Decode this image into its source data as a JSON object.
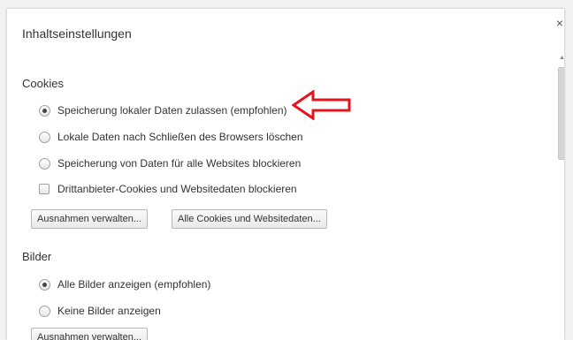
{
  "dialog": {
    "title": "Inhaltseinstellungen",
    "close_glyph": "×"
  },
  "cookies": {
    "heading": "Cookies",
    "options": [
      {
        "label": "Speicherung lokaler Daten zulassen (empfohlen)",
        "checked": true
      },
      {
        "label": "Lokale Daten nach Schließen des Browsers löschen",
        "checked": false
      },
      {
        "label": "Speicherung von Daten für alle Websites blockieren",
        "checked": false
      }
    ],
    "checkbox_label": "Drittanbieter-Cookies und Websitedaten blockieren",
    "checkbox_checked": false,
    "buttons": {
      "exceptions": "Ausnahmen verwalten...",
      "all_cookies": "Alle Cookies und Websitedaten..."
    }
  },
  "images": {
    "heading": "Bilder",
    "options": [
      {
        "label": "Alle Bilder anzeigen (empfohlen)",
        "checked": true
      },
      {
        "label": "Keine Bilder anzeigen",
        "checked": false
      }
    ],
    "buttons": {
      "exceptions": "Ausnahmen verwalten..."
    }
  },
  "annotation": {
    "arrow_color": "#e3141b",
    "arrow_icon": "arrow-left-outline-icon"
  }
}
